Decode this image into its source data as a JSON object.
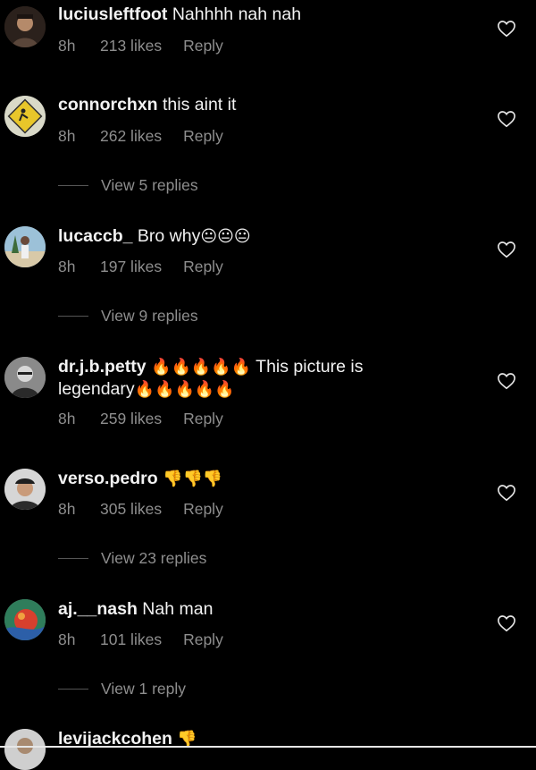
{
  "comments": [
    {
      "username": "luciusleftfoot",
      "text": " Nahhhh nah nah",
      "time": "8h",
      "likes": "213 likes",
      "reply_label": "Reply",
      "avatar_color": "#6b4e3a",
      "avatar_icon": "person-avatar-icon"
    },
    {
      "username": "connorchxn",
      "text": " this aint it",
      "time": "8h",
      "likes": "262 likes",
      "reply_label": "Reply",
      "view_replies": "View 5 replies",
      "avatar_color": "#d9d9c8",
      "avatar_icon": "warning-sign-avatar-icon"
    },
    {
      "username": "lucaccb_",
      "text": " Bro why",
      "emoji": "😐😐😐",
      "time": "8h",
      "likes": "197 likes",
      "reply_label": "Reply",
      "view_replies": "View 9 replies",
      "avatar_color": "#8fb3c9",
      "avatar_icon": "person-beach-avatar-icon"
    },
    {
      "username": "dr.j.b.petty",
      "text_before": " ",
      "emoji1": "🔥🔥🔥🔥🔥",
      "text": " This picture is legendary",
      "emoji2": "🔥🔥🔥🔥🔥",
      "time": "8h",
      "likes": "259 likes",
      "reply_label": "Reply",
      "avatar_color": "#9a9a9a",
      "avatar_icon": "person-avatar-icon"
    },
    {
      "username": "verso.pedro",
      "text": " ",
      "emoji": "👎👎👎",
      "time": "8h",
      "likes": "305 likes",
      "reply_label": "Reply",
      "view_replies": "View 23 replies",
      "avatar_color": "#cfcfcf",
      "avatar_icon": "person-cap-avatar-icon"
    },
    {
      "username": "aj.__nash",
      "text": " Nah man",
      "time": "8h",
      "likes": "101 likes",
      "reply_label": "Reply",
      "view_replies": "View 1 reply",
      "avatar_color": "#3f8f6a",
      "avatar_icon": "abstract-avatar-icon"
    },
    {
      "username": "levijackcohen",
      "text": " ",
      "emoji": "👎",
      "avatar_color": "#d0d0d0",
      "avatar_icon": "person-avatar-icon"
    }
  ],
  "colors": {
    "background": "#000000",
    "primary_text": "#f2f2f2",
    "secondary_text": "#8e8e8e",
    "heart_outline": "#e6e6e6"
  },
  "icons": {
    "like": "heart-outline-icon"
  }
}
